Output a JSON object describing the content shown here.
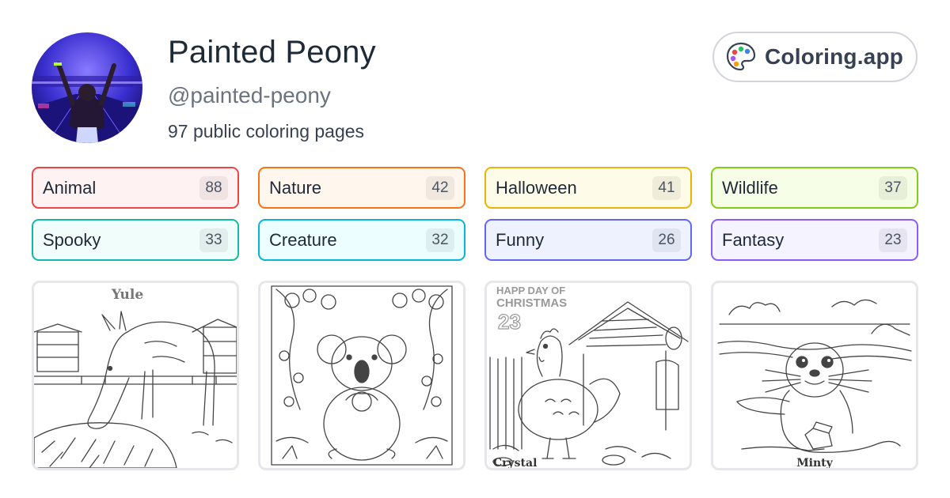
{
  "profile": {
    "name": "Painted Peony",
    "handle": "@painted-peony",
    "count_text": "97 public coloring pages"
  },
  "brand": {
    "label": "Coloring.app",
    "icon": "palette-icon"
  },
  "tags": [
    {
      "label": "Animal",
      "count": "88",
      "border": "#ef4444",
      "bg": "#fef2f2"
    },
    {
      "label": "Nature",
      "count": "42",
      "border": "#f97316",
      "bg": "#fff7ed"
    },
    {
      "label": "Halloween",
      "count": "41",
      "border": "#eab308",
      "bg": "#fefce8"
    },
    {
      "label": "Wildlife",
      "count": "37",
      "border": "#84cc16",
      "bg": "#f7fee7"
    },
    {
      "label": "Spooky",
      "count": "33",
      "border": "#14b8a6",
      "bg": "#f0fdfa"
    },
    {
      "label": "Creature",
      "count": "32",
      "border": "#06b6d4",
      "bg": "#ecfeff"
    },
    {
      "label": "Funny",
      "count": "26",
      "border": "#6366f1",
      "bg": "#eef2ff"
    },
    {
      "label": "Fantasy",
      "count": "23",
      "border": "#8b5cf6",
      "bg": "#f5f3ff"
    }
  ],
  "cards": [
    {
      "subject": "donkey",
      "caption": "Yule"
    },
    {
      "subject": "koala",
      "caption": ""
    },
    {
      "subject": "chicken",
      "caption": "Crystal",
      "header_line1": "HAPP DAY OF",
      "header_line2": "CHRISTMAS",
      "header_number": "23"
    },
    {
      "subject": "seal",
      "caption": "Minty"
    }
  ]
}
